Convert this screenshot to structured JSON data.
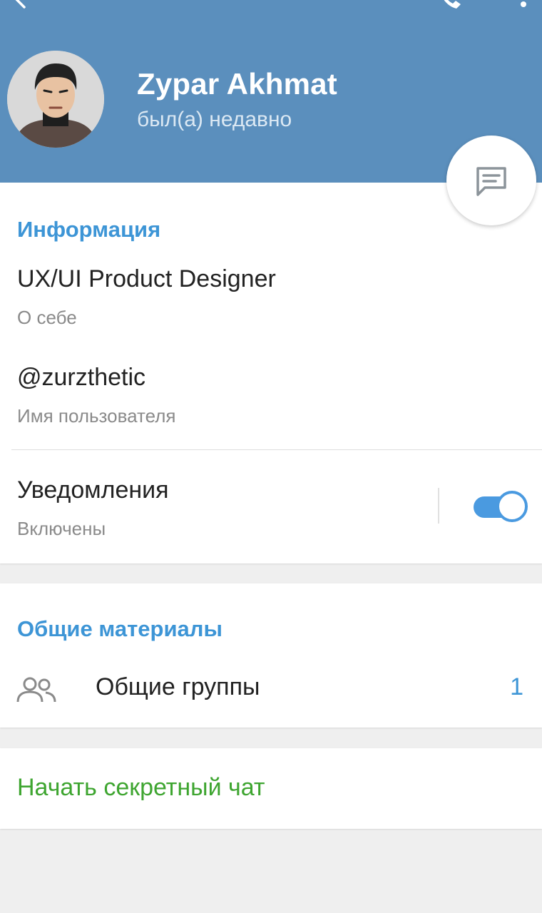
{
  "header": {
    "name": "Zypar Akhmat",
    "status": "был(а) недавно",
    "bg_color": "#5b8fbd"
  },
  "icons": {
    "back": "back-arrow-icon",
    "call": "phone-icon",
    "more": "more-vertical-icon",
    "message": "message-icon",
    "groups": "groups-icon"
  },
  "info": {
    "section_title": "Информация",
    "bio_value": "UX/UI Product Designer",
    "bio_label": "О себе",
    "username_value": "@zurzthetic",
    "username_label": "Имя пользователя",
    "notifications_label": "Уведомления",
    "notifications_status": "Включены",
    "notifications_on": true
  },
  "shared": {
    "section_title": "Общие материалы",
    "groups_label": "Общие группы",
    "groups_count": "1"
  },
  "secret": {
    "label": "Начать секретный чат",
    "color": "#3ea530"
  },
  "accent_color": "#3d95d6"
}
